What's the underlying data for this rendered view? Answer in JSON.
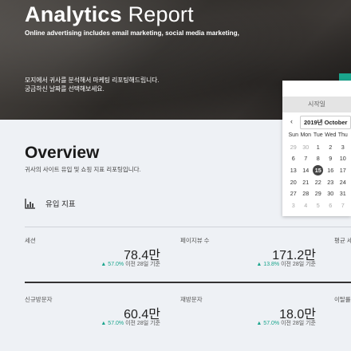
{
  "hero": {
    "title_bold": "Analytics",
    "title_light": "Report",
    "subtitle": "Online advertising includes email marketing, social media marketing,",
    "description": "모지에서 귀사를 분석해서 마케팅 리포팅해드립니다.\n궁금하신 날짜를 선택해보세요."
  },
  "overview": {
    "title": "Overview",
    "description": "귀사의 사이트 유입 및 쇼핑 지표 리포팅입니다.",
    "section_label": "유입 지표"
  },
  "metrics": [
    {
      "label": "세션",
      "value": "78.4만",
      "change": "57.0%",
      "period": "이전 28일 기준"
    },
    {
      "label": "페이지뷰 수",
      "value": "171.2만",
      "change": "13.8%",
      "period": "이전 28일 기준"
    },
    {
      "label": "평균 세",
      "value": "",
      "change": "",
      "period": ""
    },
    {
      "label": "신규방문자",
      "value": "60.4만",
      "change": "57.0%",
      "period": "이전 28일 기준"
    },
    {
      "label": "재방문자",
      "value": "18.0만",
      "change": "57.0%",
      "period": "이전 28일 기준"
    },
    {
      "label": "이탈률",
      "value": "",
      "change": "",
      "period": ""
    }
  ],
  "calendar": {
    "header": "시작일",
    "month_label": "2019년 October",
    "prev_icon": "chevron-left-icon",
    "weekdays": [
      "Sun",
      "Mon",
      "Tue",
      "Wed",
      "Thu"
    ],
    "weeks": [
      [
        {
          "d": "29",
          "m": true
        },
        {
          "d": "30",
          "m": true
        },
        {
          "d": "1"
        },
        {
          "d": "2"
        },
        {
          "d": "3"
        }
      ],
      [
        {
          "d": "6"
        },
        {
          "d": "7"
        },
        {
          "d": "8"
        },
        {
          "d": "9"
        },
        {
          "d": "10"
        }
      ],
      [
        {
          "d": "13"
        },
        {
          "d": "14"
        },
        {
          "d": "15",
          "s": true
        },
        {
          "d": "16"
        },
        {
          "d": "17"
        }
      ],
      [
        {
          "d": "20"
        },
        {
          "d": "21"
        },
        {
          "d": "22"
        },
        {
          "d": "23"
        },
        {
          "d": "24"
        }
      ],
      [
        {
          "d": "27"
        },
        {
          "d": "28"
        },
        {
          "d": "29"
        },
        {
          "d": "30"
        },
        {
          "d": "31"
        }
      ],
      [
        {
          "d": "3",
          "m": true
        },
        {
          "d": "4",
          "m": true
        },
        {
          "d": "5",
          "m": true
        },
        {
          "d": "6",
          "m": true
        },
        {
          "d": "7",
          "m": true
        }
      ]
    ]
  },
  "colors": {
    "accent": "#1aa58d",
    "dark": "#444444"
  }
}
